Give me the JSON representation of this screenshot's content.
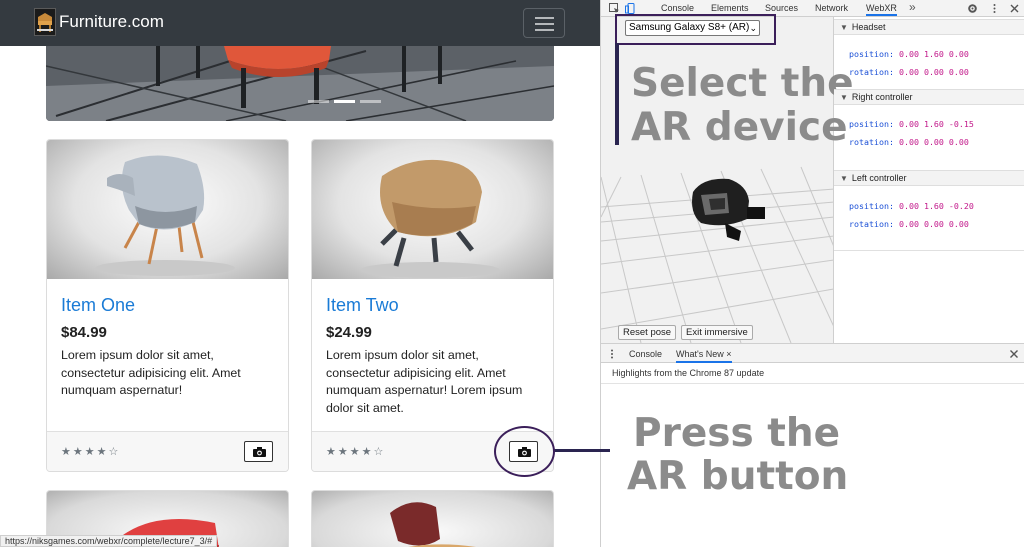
{
  "site": {
    "brand": "Furniture.com",
    "status_url": "https://niksgames.com/webxr/complete/lecture7_3/#",
    "cards": [
      {
        "title": "Item One",
        "price": "$84.99",
        "text": "Lorem ipsum dolor sit amet, consectetur adipisicing elit. Amet numquam aspernatur!",
        "rating": 4,
        "stars": "★★★★☆"
      },
      {
        "title": "Item Two",
        "price": "$24.99",
        "text": "Lorem ipsum dolor sit amet, consectetur adipisicing elit. Amet numquam aspernatur! Lorem ipsum dolor sit amet.",
        "rating": 4,
        "stars": "★★★★☆"
      }
    ]
  },
  "devtools": {
    "tabs": [
      "Console",
      "Elements",
      "Sources",
      "Network",
      "WebXR"
    ],
    "active_tab": "WebXR",
    "more_tabs": "»",
    "device": "Samsung Galaxy S8+ (AR)",
    "buttons": {
      "reset_pose": "Reset pose",
      "exit_immersive": "Exit immersive"
    },
    "panels": [
      {
        "title": "Headset",
        "position_label": "position:",
        "position": "0.00 1.60 0.00",
        "rotation_label": "rotation:",
        "rotation": "0.00 0.00 0.00"
      },
      {
        "title": "Right controller",
        "position_label": "position:",
        "position": "0.00 1.60 -0.15",
        "rotation_label": "rotation:",
        "rotation": "0.00 0.00 0.00"
      },
      {
        "title": "Left controller",
        "position_label": "position:",
        "position": "0.00 1.60 -0.20",
        "rotation_label": "rotation:",
        "rotation": "0.00 0.00 0.00"
      }
    ],
    "drawer": {
      "tabs": [
        "Console",
        "What's New"
      ],
      "close_glyph": "×",
      "highlights": "Highlights from the Chrome 87 update"
    }
  },
  "annotations": {
    "select_line1": "Select the",
    "select_line2": "AR device",
    "press_line1": "Press the",
    "press_line2": "AR button"
  },
  "colors": {
    "accent_annotation": "#3b1f5a",
    "link_blue": "#1a7bd6",
    "navbar": "#343a40"
  }
}
